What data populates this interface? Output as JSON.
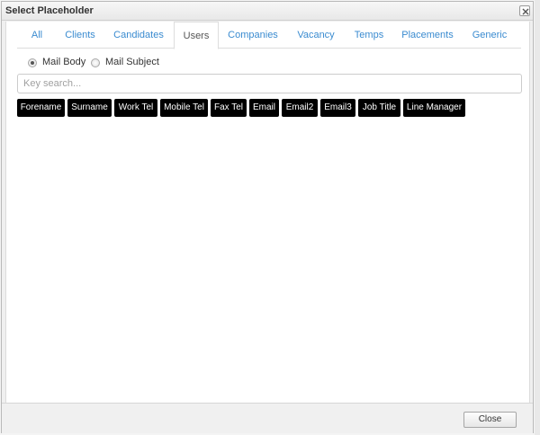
{
  "dialog": {
    "title": "Select Placeholder",
    "close_icon": "close-x-icon"
  },
  "tabs": [
    {
      "label": "All",
      "active": false
    },
    {
      "label": "Clients",
      "active": false
    },
    {
      "label": "Candidates",
      "active": false
    },
    {
      "label": "Users",
      "active": true
    },
    {
      "label": "Companies",
      "active": false
    },
    {
      "label": "Vacancy",
      "active": false
    },
    {
      "label": "Temps",
      "active": false
    },
    {
      "label": "Placements",
      "active": false
    },
    {
      "label": "Generic",
      "active": false
    }
  ],
  "mail_target": {
    "options": [
      {
        "label": "Mail Body",
        "selected": true
      },
      {
        "label": "Mail Subject",
        "selected": false
      }
    ]
  },
  "search": {
    "value": "",
    "placeholder": "Key search..."
  },
  "placeholders": [
    "Forename",
    "Surname",
    "Work Tel",
    "Mobile Tel",
    "Fax Tel",
    "Email",
    "Email2",
    "Email3",
    "Job Title",
    "Line Manager"
  ],
  "footer": {
    "close_label": "Close"
  },
  "colors": {
    "tab_link": "#3a8bd0",
    "chip_bg": "#000000",
    "chip_text": "#ffffff"
  }
}
